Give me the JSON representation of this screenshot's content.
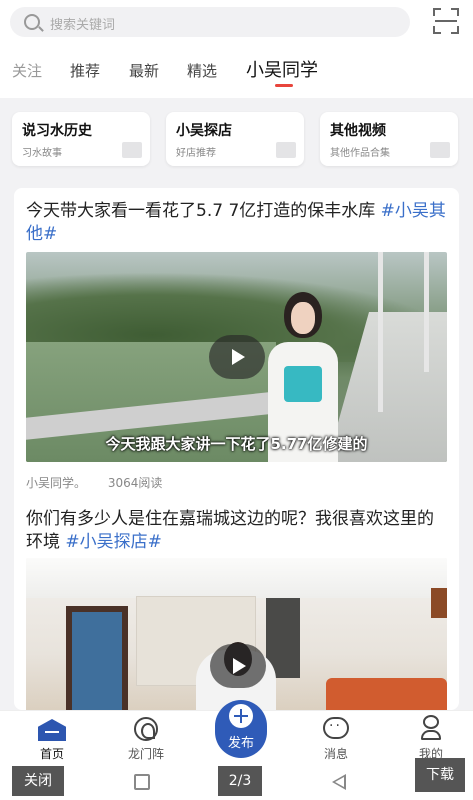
{
  "search": {
    "placeholder": "搜索关键词",
    "icon": "search-icon",
    "scan_icon": "scan-icon"
  },
  "tabs": [
    {
      "label": "关注"
    },
    {
      "label": "推荐"
    },
    {
      "label": "最新"
    },
    {
      "label": "精选"
    },
    {
      "label": "小吴同学",
      "active": true
    }
  ],
  "categories": [
    {
      "title": "说习水历史",
      "subtitle": "习水故事"
    },
    {
      "title": "小吴探店",
      "subtitle": "好店推荐"
    },
    {
      "title": "其他视频",
      "subtitle": "其他作品合集"
    }
  ],
  "posts": [
    {
      "title": "今天带大家看一看花了5.7 7亿打造的保丰水库 ",
      "tag": "#小吴其他#",
      "caption": "今天我跟大家讲一下花了5.77亿修建的",
      "author": "小吴同学。",
      "views": "3064阅读"
    },
    {
      "title": "你们有多少人是住在嘉瑞城这边的呢？我很喜欢这里的环境 ",
      "tag": "#小吴探店#"
    }
  ],
  "bottom_nav": {
    "home": "首页",
    "dragon": "龙门阵",
    "publish": "发布",
    "messages": "消息",
    "me": "我的"
  },
  "system_bar": {
    "close": "关闭",
    "page": "2/3",
    "download": "下载"
  },
  "colors": {
    "accent": "#2f5bb8",
    "tag": "#3a6fc9",
    "indicator": "#e8453c"
  }
}
